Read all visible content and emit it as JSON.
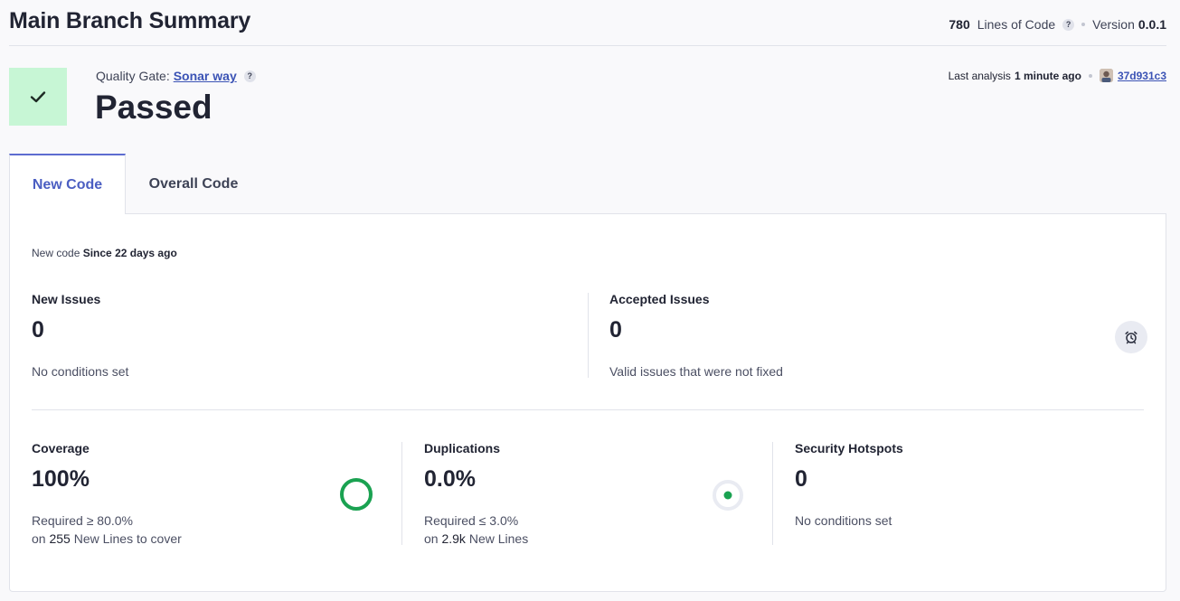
{
  "header": {
    "title": "Main Branch Summary",
    "lines_of_code_value": "780",
    "lines_of_code_label": "Lines of Code",
    "help": "?",
    "version_label": "Version",
    "version_value": "0.0.1"
  },
  "quality_gate": {
    "label": "Quality Gate:",
    "name": "Sonar way",
    "help": "?",
    "status": "Passed",
    "status_color": "#c7f6d5"
  },
  "analysis": {
    "label": "Last analysis",
    "time": "1 minute ago",
    "commit": "37d931c3"
  },
  "tabs": [
    {
      "label": "New Code",
      "active": true
    },
    {
      "label": "Overall Code",
      "active": false
    }
  ],
  "period": {
    "label": "New code",
    "value": "Since 22 days ago"
  },
  "metrics": {
    "new_issues": {
      "title": "New Issues",
      "value": "0",
      "description": "No conditions set"
    },
    "accepted_issues": {
      "title": "Accepted Issues",
      "value": "0",
      "description": "Valid issues that were not fixed",
      "icon": "alarm-clock-icon"
    },
    "coverage": {
      "title": "Coverage",
      "value": "100%",
      "required": "Required ≥ 80.0%",
      "on": "on",
      "count": "255",
      "suffix": "New Lines to cover",
      "fraction": 1.0,
      "color": "#1aa251"
    },
    "duplications": {
      "title": "Duplications",
      "value": "0.0%",
      "required": "Required ≤ 3.0%",
      "on": "on",
      "count": "2.9k",
      "suffix": "New Lines",
      "color": "#1aa251"
    },
    "security_hotspots": {
      "title": "Security Hotspots",
      "value": "0",
      "description": "No conditions set"
    }
  }
}
